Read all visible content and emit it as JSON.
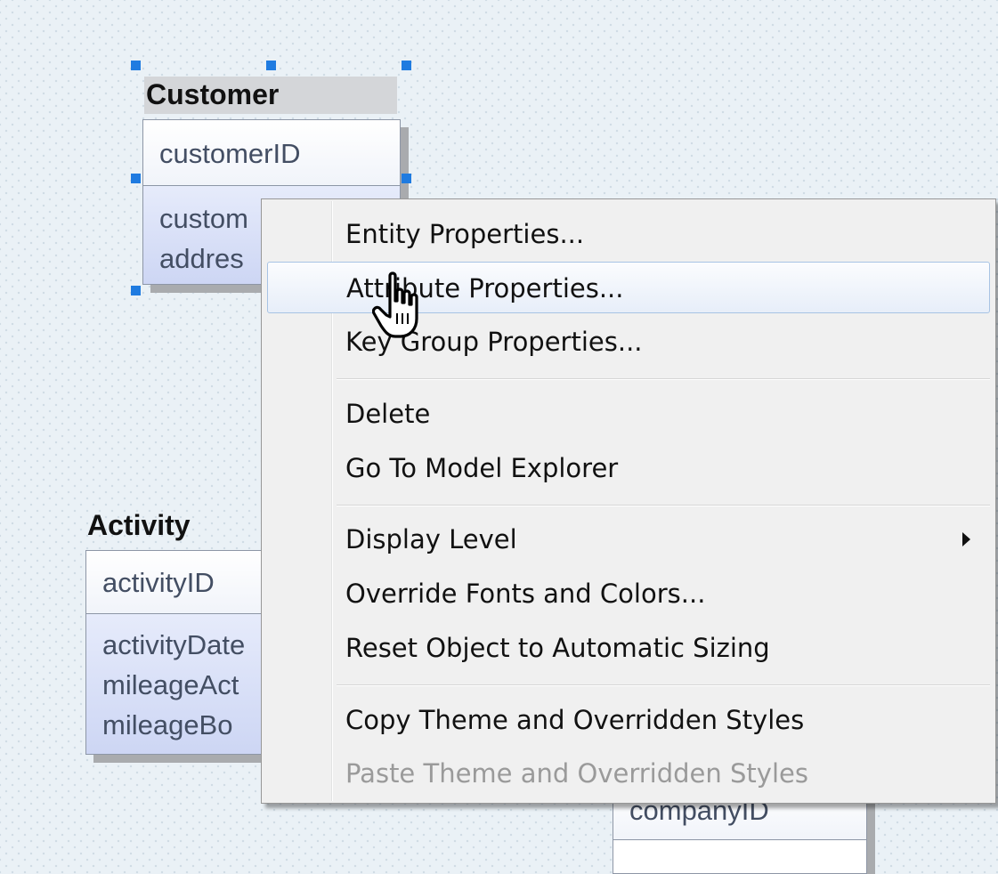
{
  "entities": {
    "customer": {
      "title": "Customer",
      "key": "customerID",
      "attributes": [
        "custom",
        "addres"
      ]
    },
    "activity": {
      "title": "Activity",
      "key": "activityID",
      "attributes": [
        "activityDate",
        "mileageAct",
        "mileageBo"
      ]
    },
    "company": {
      "key": "companyID"
    }
  },
  "context_menu": {
    "items": {
      "entity_properties": "Entity Properties...",
      "attribute_properties": "Attribute Properties...",
      "key_group_properties": "Key Group Properties...",
      "delete": "Delete",
      "go_to_model_explorer": "Go To Model Explorer",
      "display_level": "Display Level",
      "override_fonts_colors": "Override Fonts and Colors...",
      "reset_object_sizing": "Reset Object to Automatic Sizing",
      "copy_theme": "Copy Theme and Overridden Styles",
      "paste_theme": "Paste Theme and Overridden Styles"
    },
    "hovered_item": "Attribute Properties...",
    "disabled_item": "Paste Theme and Overridden Styles"
  },
  "colors": {
    "selection_handle": "#1f7be0",
    "attribute_fill": "#cdd6f4",
    "menu_background": "#f0f0f0"
  },
  "cursor": "hand-pointer-icon"
}
